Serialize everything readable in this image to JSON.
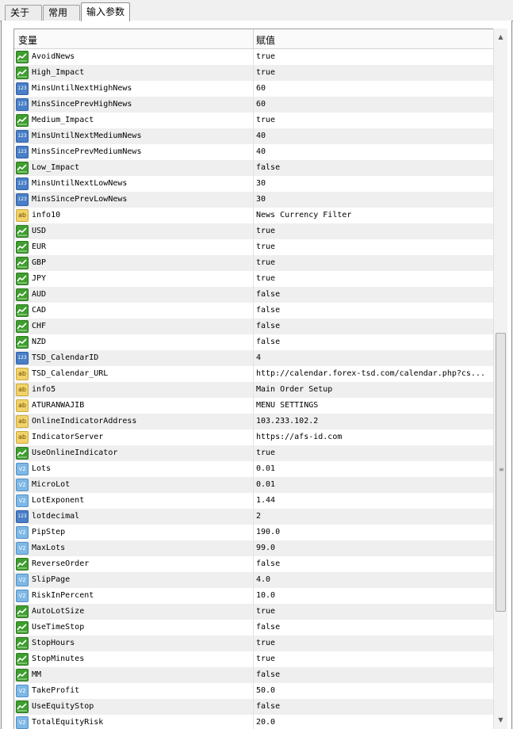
{
  "tabs": [
    {
      "label": "关于"
    },
    {
      "label": "常用"
    },
    {
      "label": "输入参数"
    }
  ],
  "grid": {
    "col_variable": "变量",
    "col_value": "赋值",
    "rows": [
      {
        "icon": "bool",
        "name": "AvoidNews",
        "value": "true"
      },
      {
        "icon": "bool",
        "name": "High_Impact",
        "value": "true"
      },
      {
        "icon": "int",
        "name": "MinsUntilNextHighNews",
        "value": "60"
      },
      {
        "icon": "int",
        "name": "MinsSincePrevHighNews",
        "value": "60"
      },
      {
        "icon": "bool",
        "name": "Medium_Impact",
        "value": "true"
      },
      {
        "icon": "int",
        "name": "MinsUntilNextMediumNews",
        "value": "40"
      },
      {
        "icon": "int",
        "name": "MinsSincePrevMediumNews",
        "value": "40"
      },
      {
        "icon": "bool",
        "name": "Low_Impact",
        "value": "false"
      },
      {
        "icon": "int",
        "name": "MinsUntilNextLowNews",
        "value": "30"
      },
      {
        "icon": "int",
        "name": "MinsSincePrevLowNews",
        "value": "30"
      },
      {
        "icon": "str",
        "name": "info10",
        "value": " News Currency Filter"
      },
      {
        "icon": "bool",
        "name": "USD",
        "value": "true"
      },
      {
        "icon": "bool",
        "name": "EUR",
        "value": "true"
      },
      {
        "icon": "bool",
        "name": "GBP",
        "value": "true"
      },
      {
        "icon": "bool",
        "name": "JPY",
        "value": "true"
      },
      {
        "icon": "bool",
        "name": "AUD",
        "value": "false"
      },
      {
        "icon": "bool",
        "name": "CAD",
        "value": "false"
      },
      {
        "icon": "bool",
        "name": "CHF",
        "value": "false"
      },
      {
        "icon": "bool",
        "name": "NZD",
        "value": "false"
      },
      {
        "icon": "int",
        "name": "TSD_CalendarID",
        "value": "4"
      },
      {
        "icon": "str",
        "name": "TSD_Calendar_URL",
        "value": " http://calendar.forex-tsd.com/calendar.php?cs..."
      },
      {
        "icon": "str",
        "name": "info5",
        "value": " Main Order Setup"
      },
      {
        "icon": "str",
        "name": "ATURANWAJIB",
        "value": "MENU SETTINGS"
      },
      {
        "icon": "str",
        "name": "OnlineIndicatorAddress",
        "value": "103.233.102.2"
      },
      {
        "icon": "str",
        "name": "IndicatorServer",
        "value": "https://afs-id.com"
      },
      {
        "icon": "bool",
        "name": "UseOnlineIndicator",
        "value": "true"
      },
      {
        "icon": "dbl",
        "name": "Lots",
        "value": "0.01"
      },
      {
        "icon": "dbl",
        "name": "MicroLot",
        "value": "0.01"
      },
      {
        "icon": "dbl",
        "name": "LotExponent",
        "value": "1.44"
      },
      {
        "icon": "int",
        "name": "lotdecimal",
        "value": "2"
      },
      {
        "icon": "dbl",
        "name": "PipStep",
        "value": "190.0"
      },
      {
        "icon": "dbl",
        "name": "MaxLots",
        "value": "99.0"
      },
      {
        "icon": "bool",
        "name": "ReverseOrder",
        "value": "false"
      },
      {
        "icon": "dbl",
        "name": "SlipPage",
        "value": "4.0"
      },
      {
        "icon": "dbl",
        "name": "RiskInPercent",
        "value": "10.0"
      },
      {
        "icon": "bool",
        "name": "AutoLotSize",
        "value": "true"
      },
      {
        "icon": "bool",
        "name": "UseTimeStop",
        "value": "false"
      },
      {
        "icon": "bool",
        "name": "StopHours",
        "value": "true"
      },
      {
        "icon": "bool",
        "name": "StopMinutes",
        "value": "true"
      },
      {
        "icon": "bool",
        "name": "MM",
        "value": "false"
      },
      {
        "icon": "dbl",
        "name": "TakeProfit",
        "value": "50.0"
      },
      {
        "icon": "bool",
        "name": "UseEquityStop",
        "value": "false"
      },
      {
        "icon": "dbl",
        "name": "TotalEquityRisk",
        "value": "20.0"
      }
    ]
  },
  "icons": {
    "bool": "bool-type-icon",
    "int": "int-type-icon",
    "dbl": "double-type-icon",
    "str": "string-type-icon"
  }
}
